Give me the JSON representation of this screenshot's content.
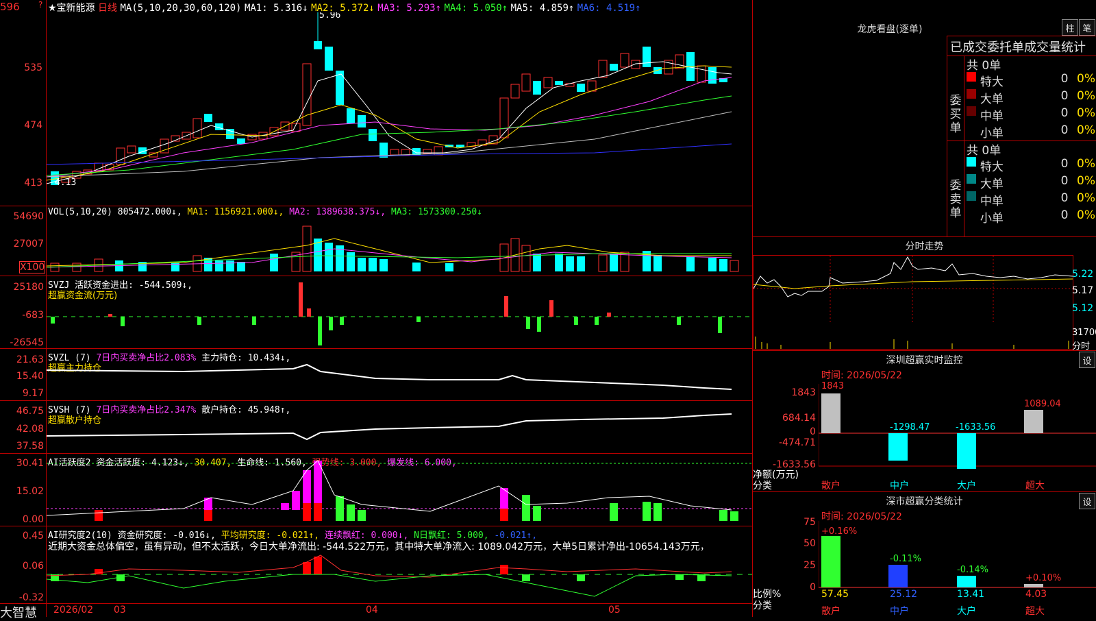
{
  "stock": {
    "name": "★宝新能源",
    "period": "日线",
    "ma_header": "MA(5,10,20,30,60,120)",
    "ma1": "MA1: 5.316↓",
    "ma2": "MA2: 5.372↓",
    "ma3": "MA3: 5.293↑",
    "ma4": "MA4: 5.050↑",
    "ma5": "MA5: 4.859↑",
    "ma6": "MA6: 4.519↑",
    "high_label": "5.96",
    "low_label": "4.13",
    "price_axis": [
      "596",
      "535",
      "474",
      "413"
    ]
  },
  "vol": {
    "header": "VOL(5,10,20)",
    "value": "805472.000↓,",
    "ma1": "MA1: 1156921.000↓,",
    "ma2": "MA2: 1389638.375↓,",
    "ma3": "MA3: 1573300.250↓",
    "axis": [
      "54690",
      "27007",
      "X100"
    ]
  },
  "svzj": {
    "header": "SVZJ",
    "text": "活跃资金进出: -544.509↓,",
    "sub": "超赢资金流(万元)",
    "axis": [
      "25180",
      "-683",
      "-26545"
    ]
  },
  "svzl": {
    "header": "SVZL (7)",
    "text1": "7日内买卖净占比2.083%",
    "text2": "主力持仓: 10.434↓,",
    "sub": "超赢主力持仓",
    "axis": [
      "21.63",
      "15.40",
      "9.17"
    ]
  },
  "svsh": {
    "header": "SVSH (7)",
    "text1": "7日内买卖净占比2.347%",
    "text2": "散户持仓: 45.948↑,",
    "sub": "超赢散户持仓",
    "axis": [
      "46.75",
      "42.08",
      "37.58"
    ]
  },
  "ai1": {
    "header": "AI活跃度2",
    "t1": "资金活跃度: 4.123↓,",
    "t2": "30.407,",
    "t3": "生命线: 1.560,",
    "t4": "强势线: 3.000,",
    "t5": "爆发线: 6.000,",
    "axis": [
      "30.41",
      "15.02",
      "0.00"
    ]
  },
  "ai2": {
    "header": "AI研究度2(10)",
    "t1": "资金研究度: -0.016↓,",
    "t2": "平均研究度: -0.021↑,",
    "t3": "连续飘红: 0.000↓,",
    "t4": "N日飘红: 5.000,",
    "t5": "-0.021↑,",
    "summary": "近期大资金总体偏空，虽有异动，但不太活跃，今日大单净流出: -544.522万元，其中特大单净流入: 1089.042万元，大单5日累计净出-10654.143万元，",
    "axis": [
      "0.45",
      "0.06",
      "-0.32"
    ]
  },
  "date_axis": {
    "brand": "大智慧",
    "labels": [
      "2026/02",
      "03",
      "04",
      "05"
    ]
  },
  "dragon": {
    "title": "龙虎看盘(逐单)",
    "btn1": "柱",
    "btn2": "笔",
    "tabs": "已成交委托单成交量统计",
    "buy_label": "委买单",
    "sell_label": "委卖单",
    "buy_total": "共 0单",
    "sell_total": "共 0单",
    "buy_rows": [
      {
        "name": "特大",
        "count": "0",
        "pct": "0%",
        "color": "#ff0000"
      },
      {
        "name": "大单",
        "count": "0",
        "pct": "0%",
        "color": "#990000"
      },
      {
        "name": "中单",
        "count": "0",
        "pct": "0%",
        "color": "#660000"
      },
      {
        "name": "小单",
        "count": "0",
        "pct": "0%",
        "color": ""
      }
    ],
    "sell_rows": [
      {
        "name": "特大",
        "count": "0",
        "pct": "0%",
        "color": "#00ffff"
      },
      {
        "name": "大单",
        "count": "0",
        "pct": "0%",
        "color": "#008888"
      },
      {
        "name": "中单",
        "count": "0",
        "pct": "0%",
        "color": "#006666"
      },
      {
        "name": "小单",
        "count": "0",
        "pct": "0%",
        "color": ""
      }
    ]
  },
  "intraday": {
    "title": "分时走势",
    "axis": [
      "5.22",
      "5.17",
      "5.12"
    ],
    "vol_label": "31700",
    "vol_unit": "分时"
  },
  "monitor": {
    "title": "深圳超赢实时监控",
    "btn": "设",
    "time": "时间: 2026/05/22",
    "axis": [
      "1843",
      "684.14",
      "0",
      "-474.71",
      "-1633.56"
    ],
    "unit": "净额(万元)",
    "cat_label": "分类",
    "categories": [
      "散户",
      "中户",
      "大户",
      "超大"
    ],
    "values": [
      "1843",
      "-1298.47",
      "-1633.56",
      "1089.04"
    ]
  },
  "classify": {
    "title": "深市超赢分类统计",
    "btn": "设",
    "time": "时间: 2026/05/22",
    "axis": [
      "75",
      "50",
      "25",
      "0"
    ],
    "unit": "比例%",
    "cat_label": "分类",
    "categories": [
      "散户",
      "中户",
      "大户",
      "超大"
    ],
    "changes": [
      "+0.16%",
      "-0.11%",
      "-0.14%",
      "+0.10%"
    ],
    "values": [
      "57.45",
      "25.12",
      "13.41",
      "4.03"
    ]
  }
}
